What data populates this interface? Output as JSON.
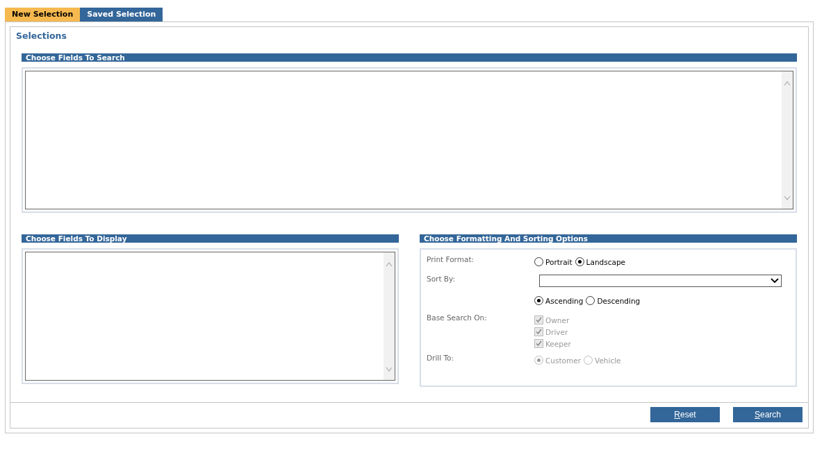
{
  "tabs": [
    {
      "label": "New Selection",
      "selected": true
    },
    {
      "label": "Saved Selection",
      "selected": false
    }
  ],
  "title": "Selections",
  "search_fields": {
    "header": "Choose Fields To Search"
  },
  "display_fields": {
    "header": "Choose Fields To Display"
  },
  "options": {
    "header": "Choose Formatting And Sorting Options",
    "rows": [
      {
        "kind": "radio",
        "label": "Print Format:",
        "disabled": false,
        "items": [
          {
            "label": "Portrait",
            "selected": false
          },
          {
            "label": "Landscape",
            "selected": true
          }
        ]
      },
      {
        "kind": "select",
        "label": "Sort By:"
      },
      {
        "kind": "radio",
        "label": "",
        "disabled": false,
        "items": [
          {
            "label": "Ascending",
            "selected": true
          },
          {
            "label": "Descending",
            "selected": false
          }
        ]
      },
      {
        "kind": "checks",
        "label": "Base Search On:",
        "disabled": true,
        "items": [
          {
            "label": "Owner",
            "checked": true
          },
          {
            "label": "Driver",
            "checked": true
          },
          {
            "label": "Keeper",
            "checked": true
          }
        ]
      },
      {
        "kind": "radio",
        "label": "Drill To:",
        "disabled": true,
        "items": [
          {
            "label": "Customer",
            "selected": true
          },
          {
            "label": "Vehicle",
            "selected": false
          }
        ]
      }
    ]
  },
  "buttons": [
    "Reset",
    "Search"
  ]
}
